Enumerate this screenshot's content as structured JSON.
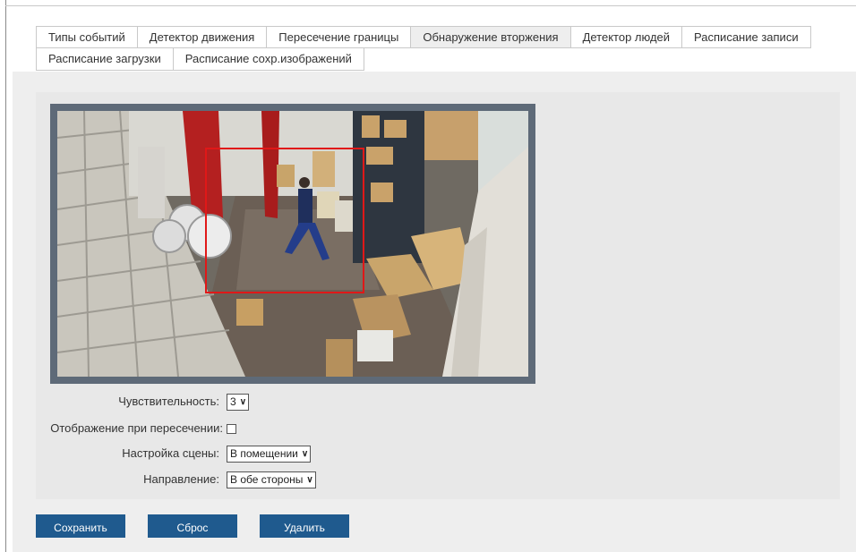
{
  "tabs": {
    "row1": [
      "Типы событий",
      "Детектор движения",
      "Пересечение границы",
      "Обнаружение вторжения",
      "Детектор людей",
      "Расписание записи"
    ],
    "row2": [
      "Расписание загрузки",
      "Расписание сохр.изображений"
    ],
    "active": "Обнаружение вторжения"
  },
  "form": {
    "sensitivity_label": "Чувствительность:",
    "sensitivity_value": "3",
    "display_label": "Отображение при пересечении:",
    "display_checked": false,
    "scene_label": "Настройка сцены:",
    "scene_value": "В помещении",
    "direction_label": "Направление:",
    "direction_value": "В обе стороны"
  },
  "buttons": {
    "save": "Сохранить",
    "reset": "Сброс",
    "delete": "Удалить"
  },
  "colors": {
    "accent": "#1f5a8e",
    "region": "#e01818"
  }
}
